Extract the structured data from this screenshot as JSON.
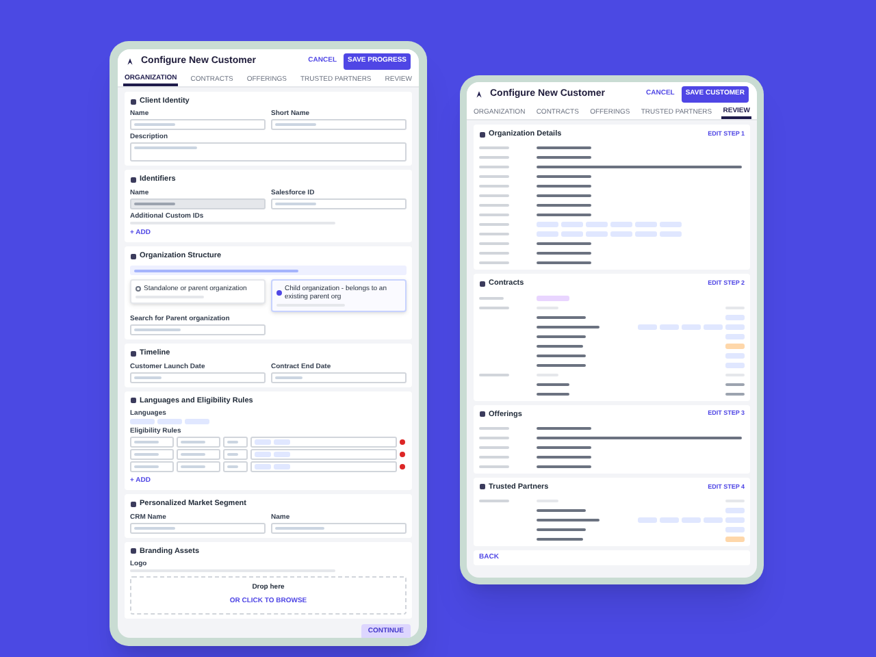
{
  "form": {
    "title": "Configure New Customer",
    "cancel": "CANCEL",
    "save": "SAVE PROGRESS",
    "steps": [
      {
        "label": "ORGANIZATION",
        "selected": true
      },
      {
        "label": "CONTRACTS",
        "selected": false
      },
      {
        "label": "OFFERINGS",
        "selected": false
      },
      {
        "label": "TRUSTED PARTNERS",
        "selected": false
      },
      {
        "label": "REVIEW",
        "selected": false
      }
    ],
    "sections": [
      {
        "title": "Client Identity",
        "rows": [
          [
            {
              "kind": "field",
              "label": "Name"
            },
            {
              "kind": "field",
              "label": "Short Name"
            }
          ],
          [
            {
              "kind": "area",
              "label": "Description"
            }
          ]
        ]
      },
      {
        "title": "Identifiers",
        "rows": [
          [
            {
              "kind": "readonly",
              "label": "Name"
            },
            {
              "kind": "field",
              "label": "Salesforce ID"
            }
          ],
          [
            {
              "kind": "text",
              "label": "Additional Custom IDs"
            }
          ],
          [
            {
              "kind": "link",
              "label": "+ ADD"
            }
          ]
        ]
      },
      {
        "title": "Organization Structure",
        "rows": [
          [
            {
              "kind": "note"
            }
          ],
          [
            {
              "kind": "radio",
              "label": "Standalone or parent organization",
              "selected": false
            },
            {
              "kind": "radio",
              "label": "Child organization - belongs to an existing parent org",
              "selected": true
            }
          ],
          [
            {
              "kind": "search",
              "label": "Search for Parent organization"
            },
            {
              "kind": "blank"
            }
          ]
        ]
      },
      {
        "title": "Timeline",
        "rows": [
          [
            {
              "kind": "date",
              "label": "Customer Launch Date"
            },
            {
              "kind": "date",
              "label": "Contract End Date"
            }
          ]
        ]
      },
      {
        "title": "Languages and Eligibility Rules",
        "rows": [
          [
            {
              "kind": "tags",
              "label": "Languages"
            }
          ],
          [
            {
              "kind": "rules",
              "label": "Eligibility Rules"
            }
          ],
          [
            {
              "kind": "link",
              "label": "+ ADD"
            }
          ]
        ]
      },
      {
        "title": "Personalized Market Segment",
        "rows": [
          [
            {
              "kind": "field",
              "label": "CRM Name"
            },
            {
              "kind": "select",
              "label": "Name"
            }
          ]
        ]
      },
      {
        "title": "Branding Assets",
        "rows": [
          [
            {
              "kind": "text",
              "label": "Logo"
            }
          ],
          [
            {
              "kind": "upload",
              "label": "Drop here",
              "link": "OR CLICK TO BROWSE"
            }
          ]
        ]
      }
    ],
    "continue": "CONTINUE"
  },
  "review": {
    "title": "Configure New Customer",
    "cancel": "CANCEL",
    "save": "SAVE CUSTOMER",
    "steps": [
      {
        "label": "ORGANIZATION",
        "selected": false
      },
      {
        "label": "CONTRACTS",
        "selected": false
      },
      {
        "label": "OFFERINGS",
        "selected": false
      },
      {
        "label": "TRUSTED PARTNERS",
        "selected": false
      },
      {
        "label": "REVIEW",
        "selected": true
      }
    ],
    "sections": [
      {
        "title": "Organization Details",
        "edit": "EDIT STEP 1",
        "rows": [
          {
            "kind": "text"
          },
          {
            "kind": "text"
          },
          {
            "kind": "long"
          },
          {
            "kind": "text"
          },
          {
            "kind": "text"
          },
          {
            "kind": "text"
          },
          {
            "kind": "text"
          },
          {
            "kind": "text"
          },
          {
            "kind": "tags"
          },
          {
            "kind": "tags"
          },
          {
            "kind": "text"
          },
          {
            "kind": "text"
          },
          {
            "kind": "text"
          }
        ]
      },
      {
        "title": "Contracts",
        "edit": "EDIT STEP 2",
        "rows": [
          {
            "kind": "tag"
          },
          {
            "kind": "header"
          },
          {
            "kind": "available"
          },
          {
            "kind": "population"
          },
          {
            "kind": "available"
          },
          {
            "kind": "pending"
          },
          {
            "kind": "available"
          },
          {
            "kind": "available"
          },
          {
            "kind": "header"
          },
          {
            "kind": "date"
          },
          {
            "kind": "date"
          }
        ]
      },
      {
        "title": "Offerings",
        "edit": "EDIT STEP 3",
        "rows": [
          {
            "kind": "text"
          },
          {
            "kind": "long"
          },
          {
            "kind": "text"
          },
          {
            "kind": "text"
          },
          {
            "kind": "text"
          }
        ]
      },
      {
        "title": "Trusted Partners",
        "edit": "EDIT STEP 4",
        "rows": [
          {
            "kind": "header"
          },
          {
            "kind": "available"
          },
          {
            "kind": "population"
          },
          {
            "kind": "available"
          },
          {
            "kind": "pending"
          }
        ]
      }
    ],
    "back": "BACK"
  }
}
